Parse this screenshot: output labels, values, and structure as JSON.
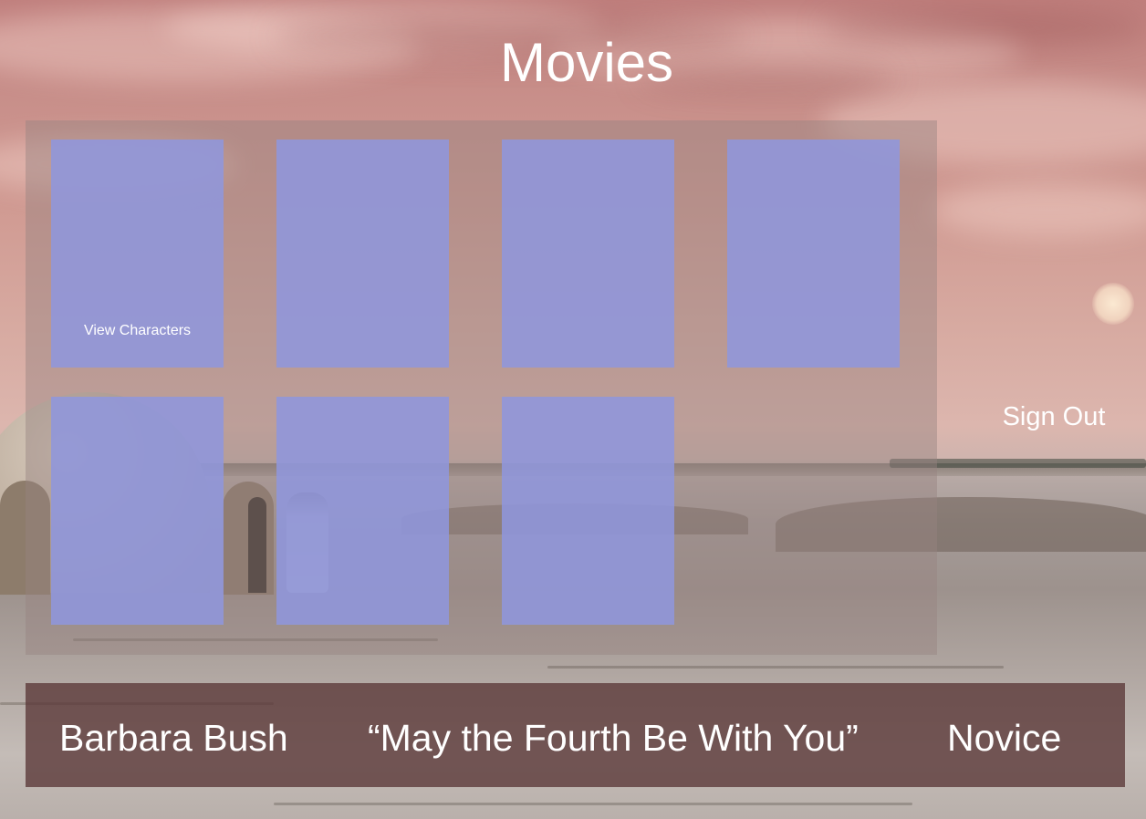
{
  "page": {
    "title": "Movies",
    "sign_out_label": "Sign Out"
  },
  "movies": {
    "cards": [
      {
        "label": "View Characters"
      },
      {
        "label": ""
      },
      {
        "label": ""
      },
      {
        "label": ""
      },
      {
        "label": ""
      },
      {
        "label": ""
      },
      {
        "label": ""
      }
    ],
    "card_color": "#9096dc"
  },
  "footer": {
    "user_name": "Barbara Bush",
    "quote": "“May the Fourth Be With You”",
    "rank": "Novice"
  },
  "colors": {
    "footer_bar": "#5a3737",
    "sky": "#c88f8a"
  }
}
